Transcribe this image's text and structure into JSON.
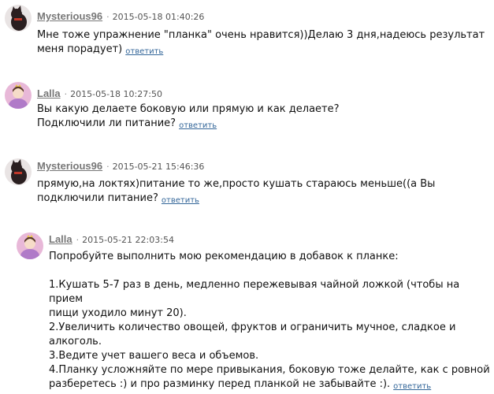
{
  "comments": [
    {
      "author": "Mysterious96",
      "date": "2015-05-18 01:40:26",
      "avatar": "dark-cat-avatar-icon",
      "text": "Мне тоже упражнение \"планка\" очень нравится))Делаю 3 дня,надеюсь результат\nменя порадует)",
      "reply_label": "ответить"
    },
    {
      "author": "Lalla",
      "date": "2015-05-18 10:27:50",
      "avatar": "princess-avatar-icon",
      "text": "Вы какую делаете боковую или прямую и как делаете?\nПодключили ли питание?",
      "reply_label": "ответить"
    },
    {
      "author": "Mysterious96",
      "date": "2015-05-21 15:46:36",
      "avatar": "dark-cat-avatar-icon",
      "text": "прямую,на локтях)питание то же,просто кушать стараюсь меньше((а Вы\nподключили питание?",
      "reply_label": "ответить"
    },
    {
      "author": "Lalla",
      "date": "2015-05-21 22:03:54",
      "avatar": "princess-avatar-icon",
      "text": "Попробуйте выполнить мою рекомендацию в добавок к планке:\n\n1.Кушать 5-7 раз в день, медленно пережевывая чайной ложкой (чтобы на прием\nпищи уходило минут 20).\n2.Увеличить количество овощей, фруктов и ограничить мучное, сладкое и\nалкоголь.\n3.Ведите учет вашего веса и объемов.\n4.Планку усложняйте по мере привыкания, боковую тоже делайте, как с ровной\nразберетесь :) и про разминку перед планкой не забывайте :).",
      "reply_label": "ответить"
    }
  ],
  "separator": "·",
  "colors": {
    "author": "#777777",
    "reply_link": "#336699",
    "text": "#111111"
  }
}
